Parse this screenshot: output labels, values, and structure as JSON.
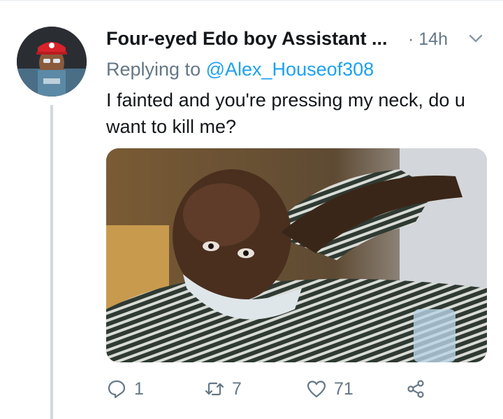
{
  "tweet": {
    "author_name": "Four-eyed Edo boy Assistant ...",
    "time": "· 14h",
    "replying_prefix": "Replying to",
    "replying_handle": "@Alex_Houseof308",
    "text": "I fainted and you're pressing my neck, do u want to kill me?"
  },
  "actions": {
    "reply_count": "1",
    "retweet_count": "7",
    "like_count": "71"
  },
  "icons": {
    "more": "chevron-down-icon",
    "reply": "reply-icon",
    "retweet": "retweet-icon",
    "like": "heart-icon",
    "share": "share-icon"
  },
  "colors": {
    "text_primary": "#14171a",
    "text_secondary": "#657786",
    "link": "#1da1f2",
    "thread_line": "#cfd9de"
  }
}
